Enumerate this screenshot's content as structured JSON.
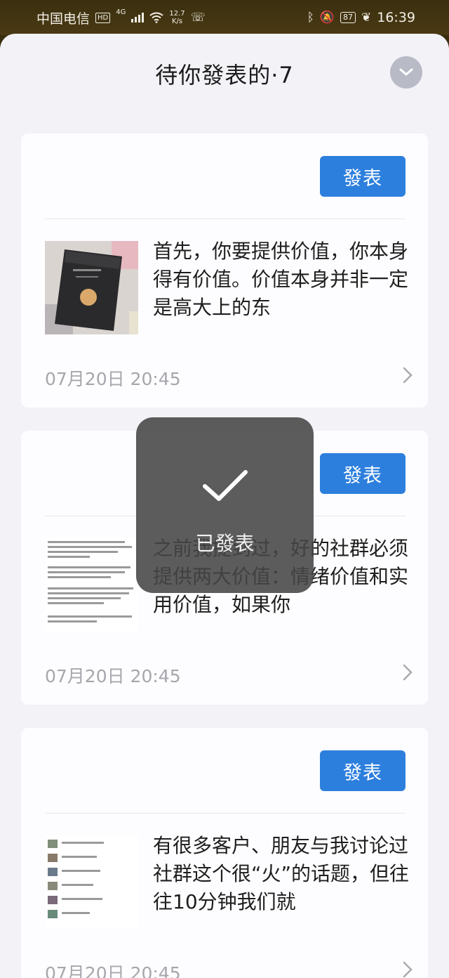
{
  "status_bar": {
    "carrier": "中国电信",
    "hd": "HD",
    "network": "4G",
    "speed_value": "12.7",
    "speed_unit": "K/s",
    "battery": "87",
    "time": "16:39"
  },
  "sheet": {
    "title": "待你發表的·7"
  },
  "cards": [
    {
      "button": "發表",
      "excerpt": "首先，你要提供价值，你本身得有价值。价值本身并非一定是高大上的东",
      "date": "07月20日 20:45",
      "thumb_icon": "book-photo-thumbnail"
    },
    {
      "button": "發表",
      "excerpt": "之前我提到过，好的社群必须提供两大价值：情绪价值和实用价值，如果你",
      "date": "07月20日 20:45",
      "thumb_icon": "text-document-thumbnail"
    },
    {
      "button": "發表",
      "excerpt": "有很多客户、朋友与我讨论过社群这个很“火”的话题，但往往10分钟我们就",
      "date": "07月20日 20:45",
      "thumb_icon": "chat-list-thumbnail"
    }
  ],
  "toast": {
    "text": "已發表",
    "icon": "checkmark-icon"
  },
  "colors": {
    "accent": "#2d7fdd",
    "sheet_bg": "#f3f2f7",
    "status_bg": "#3a2f10"
  }
}
